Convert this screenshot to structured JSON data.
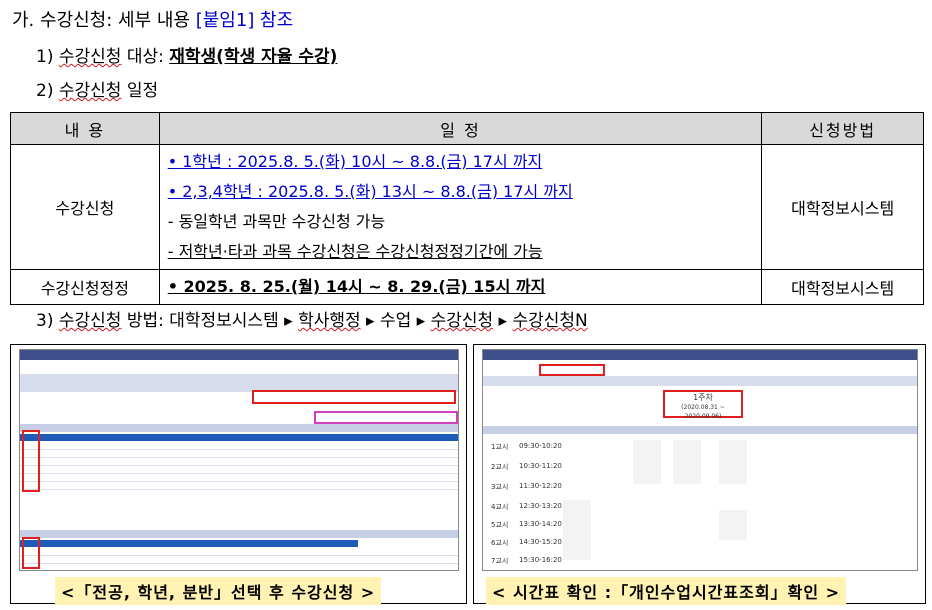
{
  "heading": {
    "prefix": "가. 수강신청: 세부 내용 ",
    "ref": "[붙임1] 참조"
  },
  "item1": {
    "prefix": "1) ",
    "label": "수강신청",
    "mid": " 대상: ",
    "value": "재학생(학생 자율 수강)"
  },
  "item2": {
    "prefix": "2) ",
    "label": "수강신청",
    "rest": " 일정"
  },
  "table": {
    "headers": [
      "내 용",
      "일 정",
      "신청방법"
    ],
    "row1": {
      "name": "수강신청",
      "lines": [
        "• 1학년 : 2025.8. 5.(화) 10시 ~ 8.8.(금) 17시 까지",
        "• 2,3,4학년 : 2025.8. 5.(화) 13시 ~ 8.8.(금) 17시 까지",
        "- 동일학년 과목만 수강신청 가능",
        "- 저학년·타과 과목 수강신청은 수강신청정정기간에 가능"
      ],
      "method": "대학정보시스템"
    },
    "row2": {
      "name": "수강신청정정",
      "line": "• 2025. 8. 25.(월) 14시 ~ 8. 29.(금) 15시 까지",
      "method": "대학정보시스템"
    }
  },
  "item3": {
    "prefix": "3) ",
    "label": "수강신청",
    "mid": " 방법: 대학정보시스템 ▸ ",
    "step1": "학사행정",
    "step2": " ▸ 수업 ▸ ",
    "step3": "수강신청",
    "step4": " ▸ ",
    "step5": "수강신청N"
  },
  "captions": {
    "left": "<「전공, 학년, 분반」선택 후 수강신청 >",
    "right": "< 시간표 확인 :「개인수업시간표조회」확인 >"
  },
  "right_shot": {
    "week": "1주차",
    "period": "(2020.08.31 ~ 2020.09.06)",
    "hours": [
      "1교시",
      "2교시",
      "3교시",
      "4교시",
      "5교시",
      "6교시",
      "7교시"
    ],
    "times": [
      "09:30-10:20",
      "10:30-11:20",
      "11:30-12:20",
      "12:30-13:20",
      "13:30-14:20",
      "14:30-15:20",
      "15:30-16:20"
    ]
  },
  "colors": {
    "blue_text": "#0000cc",
    "header_fill": "#d9d9d9",
    "caption_fill": "#fff2b3",
    "highlight_box": "#e02020"
  }
}
